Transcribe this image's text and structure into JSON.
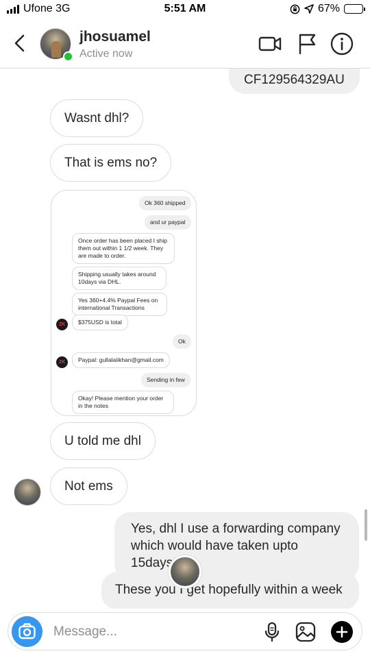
{
  "status_bar": {
    "carrier": "Ufone 3G",
    "time": "5:51 AM",
    "battery": "67%",
    "battery_level": 0.67,
    "battery_color": "#f5c518"
  },
  "header": {
    "username": "jhosuamel",
    "status": "Active now",
    "active_color": "#25c03b",
    "icons": [
      "back-chevron-icon",
      "video-call-icon",
      "flag-icon",
      "info-icon"
    ]
  },
  "messages": {
    "m0": "CF129564329AU",
    "m1": "Wasnt dhl?",
    "m2": "That is ems no?",
    "m4": "U told me dhl",
    "m5": "Not ems",
    "m6": "Yes, dhl I use a forwarding company which would have taken upto 15days.",
    "m7": "These you I get hopefully within a week"
  },
  "screenshot": {
    "s1": "Ok 360 shipped",
    "s2": "and ur paypal",
    "s3": "Once order has been placed I ship them out within 1 1/2 week. They are made to order.",
    "s4": "Shipping usually takes around 10days via DHL.",
    "s5": "Yes 360+4.4% Paypal Fees on international Transactions",
    "s6": "$375USD is total",
    "s7": "Ok",
    "s8": "Paypal: gullalaiikhan@gmail.com",
    "s9": "Sending in few",
    "s10": "Okay! Please mention your order in the notes",
    "avatar_text": "ZK"
  },
  "composer": {
    "placeholder": "Message...",
    "accent": "#3797f0",
    "icons": [
      "camera-icon",
      "microphone-icon",
      "gallery-icon",
      "plus-icon"
    ]
  }
}
